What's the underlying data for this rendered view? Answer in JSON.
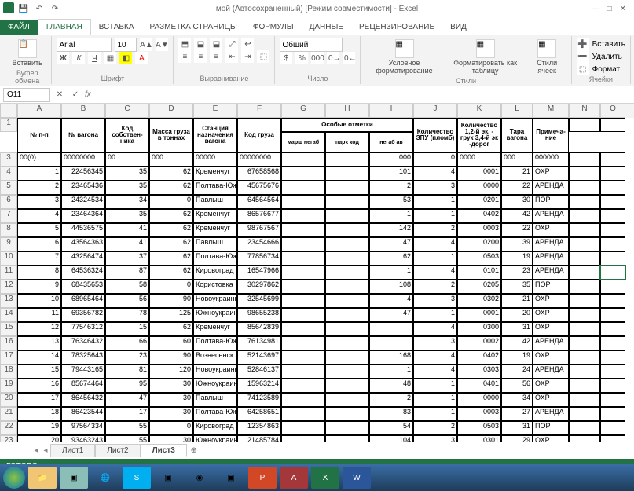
{
  "title": "мой (Автосохраненный) [Режим совместимости] - Excel",
  "tabs": {
    "file": "ФАЙЛ",
    "home": "ГЛАВНАЯ",
    "insert": "ВСТАВКА",
    "layout": "РАЗМЕТКА СТРАНИЦЫ",
    "formulas": "ФОРМУЛЫ",
    "data": "ДАННЫЕ",
    "review": "РЕЦЕНЗИРОВАНИЕ",
    "view": "ВИД"
  },
  "ribbon": {
    "clipboard": {
      "paste": "Вставить",
      "label": "Буфер обмена"
    },
    "font": {
      "name": "Arial",
      "size": "10",
      "label": "Шрифт"
    },
    "align": {
      "label": "Выравнивание"
    },
    "number": {
      "format": "Общий",
      "label": "Число"
    },
    "styles": {
      "cond": "Условное\nформатирование",
      "fmt": "Форматировать\nкак таблицу",
      "cell": "Стили\nячеек",
      "label": "Стили"
    },
    "cells": {
      "ins": "Вставить",
      "del": "Удалить",
      "fmt": "Формат",
      "label": "Ячейки"
    }
  },
  "namebox": "O11",
  "cols": [
    "A",
    "B",
    "C",
    "D",
    "E",
    "F",
    "G",
    "H",
    "I",
    "J",
    "K",
    "L",
    "M",
    "N",
    "O"
  ],
  "headers": {
    "a": "№ п-п",
    "b": "№ вагона",
    "c": "Код\nсобствен-\nника",
    "d": "Масса\nгруза в\nтоннах",
    "e": "Станция\nназначения\nвагона",
    "f": "Код груза",
    "ghi": "Особые отметки",
    "g": "марш\nнегаб",
    "h": "парк\nкод",
    "i": "негаб\nав",
    "j": "Количество\nЗПУ (пломб)",
    "k": "Количество\n1,2-й эк. -\nгрук 3,4-й\nэк -дорог",
    "l": "Тара\nвагона",
    "m": "Примеча-\nние"
  },
  "template_row": {
    "a": "00(0)",
    "b": "00000000",
    "c": "00",
    "d": "000",
    "e": "00000",
    "f": "00000000",
    "i": "000",
    "j": "0",
    "k": "0000",
    "l": "000",
    "m": "000000"
  },
  "rows": [
    {
      "n": 1,
      "b": "22456345",
      "c": 35,
      "d": 62,
      "e": "Кременчуг",
      "f": "67658568",
      "i": 101,
      "j": 4,
      "k": "0001",
      "l": 21,
      "m": "ОХР"
    },
    {
      "n": 2,
      "b": "23465436",
      "c": 35,
      "d": 62,
      "e": "Полтава-Южна",
      "f": "45675676",
      "i": 2,
      "j": 3,
      "k": "0000",
      "l": 22,
      "m": "АРЕНДА"
    },
    {
      "n": 3,
      "b": "24324534",
      "c": 34,
      "d": 0,
      "e": "Павлыш",
      "f": "64564564",
      "i": 53,
      "j": 1,
      "k": "0201",
      "l": 30,
      "m": "ПОР"
    },
    {
      "n": 4,
      "b": "23464364",
      "c": 35,
      "d": 62,
      "e": "Кременчуг",
      "f": "86576677",
      "i": 1,
      "j": 1,
      "k": "0402",
      "l": 42,
      "m": "АРЕНДА"
    },
    {
      "n": 5,
      "b": "44536575",
      "c": 41,
      "d": 62,
      "e": "Кременчуг",
      "f": "98767567",
      "i": 142,
      "j": 2,
      "k": "0003",
      "l": 22,
      "m": "ОХР"
    },
    {
      "n": 6,
      "b": "43564363",
      "c": 41,
      "d": 62,
      "e": "Павлыш",
      "f": "23454666",
      "i": 47,
      "j": 4,
      "k": "0200",
      "l": 39,
      "m": "АРЕНДА"
    },
    {
      "n": 7,
      "b": "43256474",
      "c": 37,
      "d": 62,
      "e": "Полтава-Южна",
      "f": "77856734",
      "i": 62,
      "j": 1,
      "k": "0503",
      "l": 19,
      "m": "АРЕНДА"
    },
    {
      "n": 8,
      "b": "64536324",
      "c": 87,
      "d": 62,
      "e": "Кировоград",
      "f": "16547966",
      "i": 1,
      "j": 4,
      "k": "0101",
      "l": 23,
      "m": "АРЕНДА"
    },
    {
      "n": 9,
      "b": "68435653",
      "c": 58,
      "d": 0,
      "e": "Користовка",
      "f": "30297862",
      "i": 108,
      "j": 2,
      "k": "0205",
      "l": 35,
      "m": "ПОР"
    },
    {
      "n": 10,
      "b": "68965464",
      "c": 56,
      "d": 90,
      "e": "Новоукраинка",
      "f": "32545699",
      "i": 4,
      "j": 3,
      "k": "0302",
      "l": 21,
      "m": "ОХР"
    },
    {
      "n": 11,
      "b": "69356782",
      "c": 78,
      "d": 125,
      "e": "Южноукраинская",
      "f": "98655238",
      "i": 47,
      "j": 1,
      "k": "0001",
      "l": 20,
      "m": "ОХР"
    },
    {
      "n": 12,
      "b": "77546312",
      "c": 15,
      "d": 62,
      "e": "Кременчуг",
      "f": "85642839",
      "i": "",
      "j": 4,
      "k": "0300",
      "l": 31,
      "m": "ОХР"
    },
    {
      "n": 13,
      "b": "76346432",
      "c": 66,
      "d": 60,
      "e": "Полтава-Южна",
      "f": "76134981",
      "i": "",
      "j": 3,
      "k": "0002",
      "l": 42,
      "m": "АРЕНДА"
    },
    {
      "n": 14,
      "b": "78325643",
      "c": 23,
      "d": 90,
      "e": "Вознесенск",
      "f": "52143697",
      "i": 168,
      "j": 4,
      "k": "0402",
      "l": 19,
      "m": "ОХР"
    },
    {
      "n": 15,
      "b": "79443165",
      "c": 81,
      "d": 120,
      "e": "Новоукраинка",
      "f": "52846137",
      "i": 1,
      "j": 4,
      "k": "0303",
      "l": 24,
      "m": "АРЕНДА"
    },
    {
      "n": 16,
      "b": "85674464",
      "c": 95,
      "d": 30,
      "e": "Южноукраинская",
      "f": "15963214",
      "i": 48,
      "j": 1,
      "k": "0401",
      "l": 56,
      "m": "ОХР"
    },
    {
      "n": 17,
      "b": "86456432",
      "c": 47,
      "d": 30,
      "e": "Павлыш",
      "f": "74123589",
      "i": 2,
      "j": 1,
      "k": "0000",
      "l": 34,
      "m": "ОХР"
    },
    {
      "n": 18,
      "b": "86423544",
      "c": 17,
      "d": 30,
      "e": "Полтава-Южна",
      "f": "64258651",
      "i": 83,
      "j": 1,
      "k": "0003",
      "l": 27,
      "m": "АРЕНДА"
    },
    {
      "n": 19,
      "b": "97564334",
      "c": 55,
      "d": 0,
      "e": "Кировоград",
      "f": "12354863",
      "i": 54,
      "j": 2,
      "k": "0503",
      "l": 31,
      "m": "ПОР"
    },
    {
      "n": 20,
      "b": "93463243",
      "c": 55,
      "d": 30,
      "e": "Южноукраинская",
      "f": "21485784",
      "i": 104,
      "j": 3,
      "k": "0301",
      "l": 29,
      "m": "ОХР"
    }
  ],
  "sheets": [
    "Лист1",
    "Лист2",
    "Лист3"
  ],
  "active_sheet": 2,
  "status": "ГОТОВО",
  "selected_row": 11
}
